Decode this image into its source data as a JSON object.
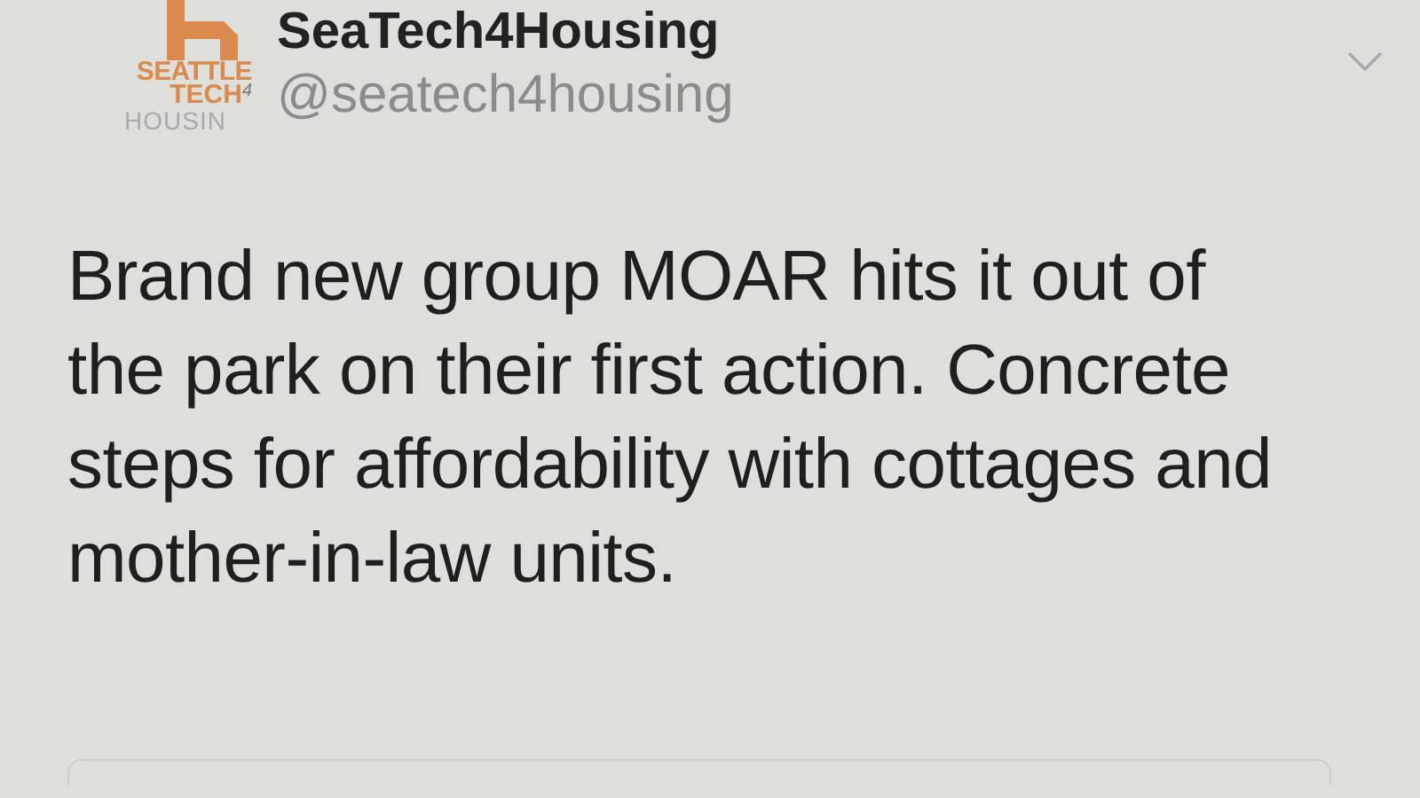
{
  "tweet": {
    "avatar": {
      "logo_lines": [
        "SEATTLE",
        "TECH",
        "4",
        "HOUSIN"
      ]
    },
    "display_name": "SeaTech4Housing",
    "handle": "@seatech4housing",
    "text_lines": [
      "Brand new group MOAR hits it out of",
      "the park on their first action. Concrete",
      "steps for affordability with cottages and",
      "mother-in-law units."
    ]
  }
}
